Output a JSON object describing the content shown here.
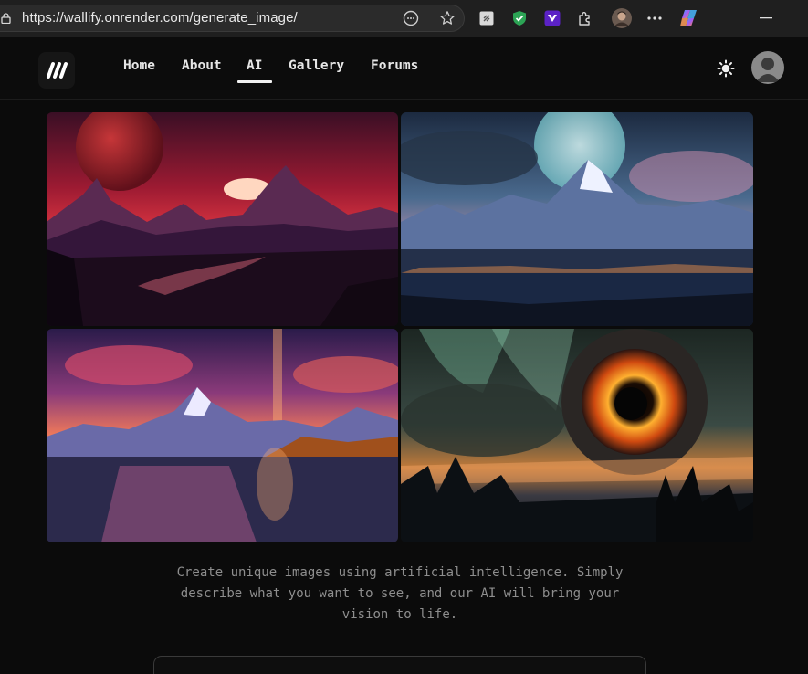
{
  "browser": {
    "url": "https://wallify.onrender.com/generate_image/"
  },
  "nav": {
    "items": [
      "Home",
      "About",
      "AI",
      "Gallery",
      "Forums"
    ],
    "active": "AI"
  },
  "gallery": {
    "images": [
      "red mountain sunset with planet",
      "blue moonlit snowy mountain lake",
      "pink sunset mountain lake reflection",
      "giant fiery eye with aurora over forest"
    ]
  },
  "main": {
    "description_lines": [
      "Create unique images using artificial intelligence. Simply",
      "describe what you want to see, and our AI will bring your",
      "vision to life."
    ]
  },
  "colors": {
    "background": "#0b0b0b",
    "text_muted": "#8e8e8e",
    "accent": "#f2f2f2"
  }
}
